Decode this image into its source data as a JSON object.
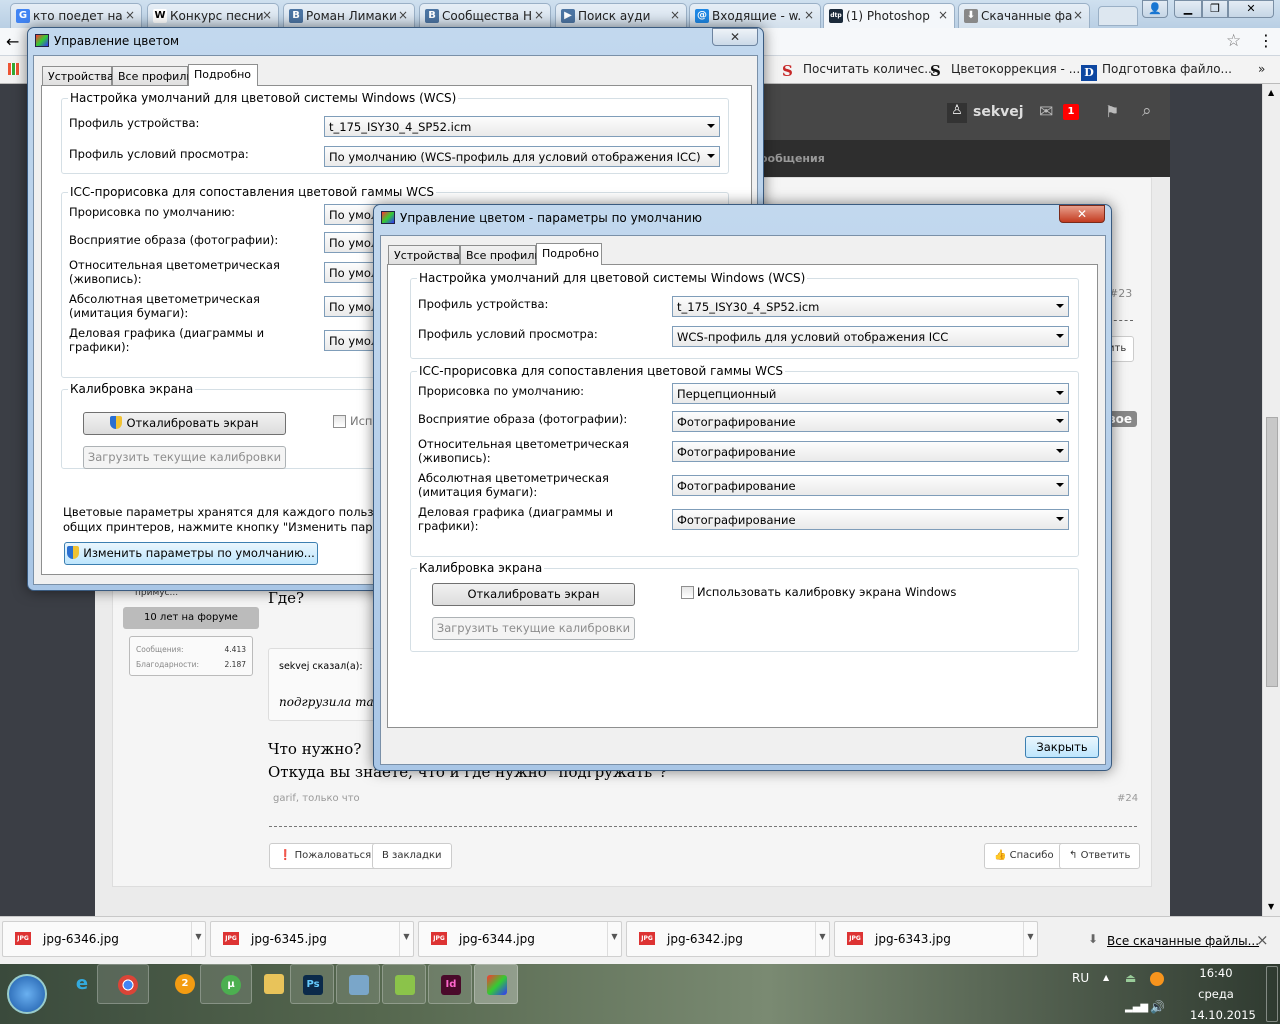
{
  "browser": {
    "tabs": [
      {
        "label": "кто поедет на",
        "icon": "google-icon",
        "color": "#4285f4",
        "glyph": "G"
      },
      {
        "label": "Конкурс песни",
        "icon": "wikipedia-icon",
        "color": "#ffffff",
        "glyph": "W"
      },
      {
        "label": "Роман Лимаки",
        "icon": "vk-icon",
        "color": "#4c75a3",
        "glyph": "В"
      },
      {
        "label": "Сообщества Н",
        "icon": "vk-icon",
        "color": "#4c75a3",
        "glyph": "В"
      },
      {
        "label": "Поиск ауди",
        "icon": "audio-icon",
        "color": "#4c75a3",
        "glyph": "▶"
      },
      {
        "label": "Входящие - w.",
        "icon": "mail-icon",
        "color": "#1e88e5",
        "glyph": "@"
      },
      {
        "label": "(1) Photoshop",
        "icon": "dtp-icon",
        "color": "#1b2a3a",
        "glyph": "dtp"
      },
      {
        "label": "Скачанные фа",
        "icon": "download-icon",
        "color": "#888888",
        "glyph": "⬇"
      }
    ],
    "close_glyph": "×",
    "bookmarks": [
      {
        "label": "Посчитать количес...",
        "glyph": "S",
        "color": "#c62828"
      },
      {
        "label": "Цветокоррекция - ...",
        "glyph": "S",
        "color": "#111111"
      },
      {
        "label": "Подготовка файло...",
        "glyph": "D",
        "color": "#0d47a1"
      }
    ],
    "more": "»"
  },
  "forum": {
    "username": "sekvej",
    "notifications": "1",
    "nav_partial": "ообщения",
    "sidebar": {
      "user_partial": "примус...",
      "badge": "10 лет на форуме",
      "stats": [
        {
          "label": "Сообщения:",
          "value": "4.413"
        },
        {
          "label": "Благодарности:",
          "value": "2.187"
        }
      ]
    },
    "post": {
      "text1": "Где?",
      "quote_author": "sekvej сказал(а):",
      "quote_text": "подгрузила там",
      "line1": "Что нужно?",
      "line2": "Откуда вы знаете, что и где нужно \"подгружать\"?",
      "meta": "garif, только что",
      "number": "#24",
      "prev_number": "#23",
      "prev_reply_partial": "ить",
      "new_badge_partial": "вое",
      "buttons": {
        "report": "Пожаловаться",
        "bookmark": "В закладки",
        "thanks": "Спасибо",
        "reply": "Ответить"
      }
    }
  },
  "dialog_main": {
    "title": "Управление цветом",
    "tabs": [
      "Устройства",
      "Все профили",
      "Подробно"
    ],
    "group1": "Настройка умолчаний для цветовой системы Windows (WCS)",
    "device_profile_label": "Профиль устройства:",
    "device_profile_value": "t_175_ISY30_4_SP52.icm",
    "viewing_label": "Профиль условий просмотра:",
    "viewing_value": "По умолчанию (WCS-профиль для условий отображения ICC)",
    "group2": "ICC-прорисовка для сопоставления цветовой гаммы WCS",
    "rows": [
      {
        "label": "Прорисовка по умолчанию:",
        "value": "По умолчанию"
      },
      {
        "label": "Восприятие образа (фотографии):",
        "value": "По умолчанию"
      },
      {
        "label": "Относительная цветометрическая\n(живопись):",
        "value": "По умолчанию"
      },
      {
        "label": "Абсолютная цветометрическая\n(имитация бумаги):",
        "value": "По умолчанию"
      },
      {
        "label": "Деловая графика (диаграммы и\nграфики):",
        "value": "По умолчанию"
      }
    ],
    "group3": "Калибровка экрана",
    "calibrate": "Откалибровать экран",
    "load_calib": "Загрузить текущие калибровки",
    "use_calib_partial": "Испо",
    "info1": "Цветовые параметры хранятся для каждого пользовател",
    "info2": "общих принтеров, нажмите кнопку \"Изменить параметр",
    "change_defaults": "Изменить параметры по умолчанию...",
    "close_glyph": "✕"
  },
  "dialog_defaults": {
    "title": "Управление цветом - параметры по умолчанию",
    "tabs": [
      "Устройства",
      "Все профили",
      "Подробно"
    ],
    "group1": "Настройка умолчаний для цветовой системы Windows (WCS)",
    "device_profile_label": "Профиль устройства:",
    "device_profile_value": "t_175_ISY30_4_SP52.icm",
    "viewing_label": "Профиль условий просмотра:",
    "viewing_value": "WCS-профиль для условий отображения ICC",
    "group2": "ICC-прорисовка для сопоставления цветовой гаммы WCS",
    "rows": [
      {
        "label": "Прорисовка по умолчанию:",
        "value": "Перцепционный"
      },
      {
        "label": "Восприятие образа (фотографии):",
        "value": "Фотографирование"
      },
      {
        "label": "Относительная цветометрическая\n(живопись):",
        "value": "Фотографирование"
      },
      {
        "label": "Абсолютная цветометрическая\n(имитация бумаги):",
        "value": "Фотографирование"
      },
      {
        "label": "Деловая графика (диаграммы и\nграфики):",
        "value": "Фотографирование"
      }
    ],
    "group3": "Калибровка экрана",
    "calibrate": "Откалибровать экран",
    "load_calib": "Загрузить текущие калибровки",
    "use_calib": "Использовать калибровку экрана Windows",
    "use_calib_checked": false,
    "close_button": "Закрыть",
    "close_glyph": "✕"
  },
  "downloads": {
    "items": [
      "jpg-6346.jpg",
      "jpg-6345.jpg",
      "jpg-6344.jpg",
      "jpg-6342.jpg",
      "jpg-6343.jpg"
    ],
    "file_badge": "JPG",
    "all_link": "Все скачанные файлы...",
    "close": "×"
  },
  "taskbar": {
    "lang": "RU",
    "time": "16:40",
    "day": "среда",
    "date": "14.10.2015"
  }
}
